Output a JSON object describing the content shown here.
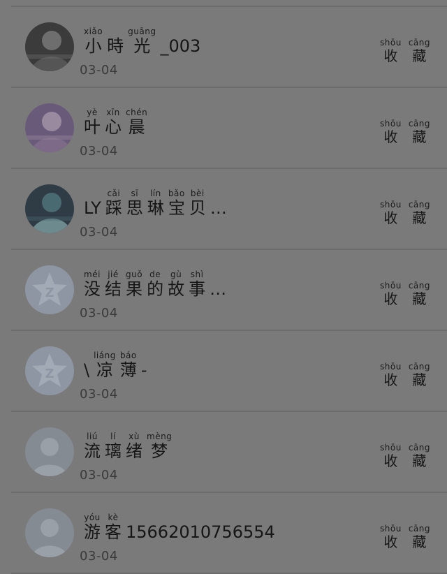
{
  "collect": [
    {
      "py": "shōu",
      "hz": "收"
    },
    {
      "py": "cāng",
      "hz": "藏"
    }
  ],
  "rows": [
    {
      "avatar": "photo",
      "name": [
        {
          "py": "xiǎo",
          "hz": "小"
        },
        {
          "py": "",
          "hz": "時"
        },
        {
          "py": "guāng",
          "hz": "光"
        },
        {
          "plain": "_003"
        }
      ],
      "date": "03-04"
    },
    {
      "avatar": "photo",
      "name": [
        {
          "py": "yè",
          "hz": "叶"
        },
        {
          "py": "xīn",
          "hz": "心"
        },
        {
          "py": "chén",
          "hz": "晨"
        }
      ],
      "date": "03-04"
    },
    {
      "avatar": "photo",
      "name": [
        {
          "plain": "LY"
        },
        {
          "py": "cǎi",
          "hz": "踩"
        },
        {
          "py": "sī",
          "hz": "思"
        },
        {
          "py": "lín",
          "hz": "琳"
        },
        {
          "py": "bǎo",
          "hz": "宝"
        },
        {
          "py": "bèi",
          "hz": "贝"
        },
        {
          "plain": "…"
        }
      ],
      "date": "03-04"
    },
    {
      "avatar": "qq-star",
      "name": [
        {
          "py": "méi",
          "hz": "没"
        },
        {
          "py": "jié",
          "hz": "结"
        },
        {
          "py": "guǒ",
          "hz": "果"
        },
        {
          "py": "de",
          "hz": "的"
        },
        {
          "py": "gù",
          "hz": "故"
        },
        {
          "py": "shì",
          "hz": "事"
        },
        {
          "plain": "…"
        }
      ],
      "date": "03-04"
    },
    {
      "avatar": "qq-star",
      "name": [
        {
          "plain": "\\"
        },
        {
          "py": "liáng",
          "hz": "凉"
        },
        {
          "py": "báo",
          "hz": "薄"
        },
        {
          "plain": "-"
        }
      ],
      "date": "03-04"
    },
    {
      "avatar": "default-user",
      "name": [
        {
          "py": "liú",
          "hz": "流"
        },
        {
          "py": "lí",
          "hz": "璃"
        },
        {
          "py": "xù",
          "hz": "绪"
        },
        {
          "py": "mèng",
          "hz": "梦"
        }
      ],
      "date": "03-04"
    },
    {
      "avatar": "default-user",
      "name": [
        {
          "py": "yóu",
          "hz": "游"
        },
        {
          "py": "kè",
          "hz": "客"
        },
        {
          "plain": "15662010756554"
        }
      ],
      "date": "03-04"
    }
  ]
}
